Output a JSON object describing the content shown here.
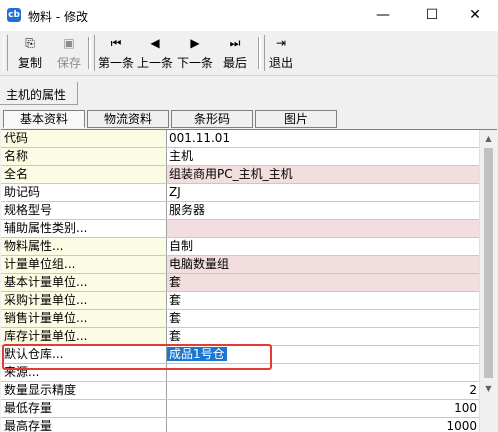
{
  "window": {
    "icon_text": "cb",
    "title": "物料 - 修改",
    "minimize": "—",
    "maximize": "☐",
    "close": "✕"
  },
  "toolbar": {
    "buttons": [
      {
        "label": "复制",
        "icon": "copy-icon",
        "glyph": "⎘",
        "enabled": true
      },
      {
        "label": "保存",
        "icon": "save-icon",
        "glyph": "▣",
        "enabled": false
      },
      {
        "label": "第一条",
        "icon": "first-record-icon",
        "glyph": "⏮",
        "enabled": true
      },
      {
        "label": "上一条",
        "icon": "previous-record-icon",
        "glyph": "◀",
        "enabled": true
      },
      {
        "label": "下一条",
        "icon": "next-record-icon",
        "glyph": "▶",
        "enabled": true
      },
      {
        "label": "最后",
        "icon": "last-record-icon",
        "glyph": "⏭",
        "enabled": true
      },
      {
        "label": "退出",
        "icon": "exit-icon",
        "glyph": "⇥",
        "enabled": true
      }
    ]
  },
  "section": {
    "label": "主机的属性"
  },
  "tabs": [
    "基本资料",
    "物流资料",
    "条形码",
    "图片"
  ],
  "properties": [
    {
      "name": "代码",
      "value": "001.11.01",
      "required": true,
      "pink": false
    },
    {
      "name": "名称",
      "value": "主机",
      "required": true,
      "pink": false
    },
    {
      "name": "全名",
      "value": "组装商用PC_主机_主机",
      "required": true,
      "pink": true
    },
    {
      "name": "助记码",
      "value": "ZJ",
      "required": false,
      "pink": false
    },
    {
      "name": "规格型号",
      "value": "服务器",
      "required": false,
      "pink": false
    },
    {
      "name": "辅助属性类别...",
      "value": "",
      "required": false,
      "pink": true
    },
    {
      "name": "物料属性...",
      "value": "自制",
      "required": true,
      "pink": false
    },
    {
      "name": "计量单位组...",
      "value": "电脑数量组",
      "required": true,
      "pink": true
    },
    {
      "name": "基本计量单位...",
      "value": "套",
      "required": true,
      "pink": true
    },
    {
      "name": "采购计量单位...",
      "value": "套",
      "required": true,
      "pink": false
    },
    {
      "name": "销售计量单位...",
      "value": "套",
      "required": true,
      "pink": false
    },
    {
      "name": "库存计量单位...",
      "value": "套",
      "required": true,
      "pink": false
    },
    {
      "name": "默认仓库...",
      "value": "成品1号仓",
      "required": false,
      "pink": false,
      "selected": true
    },
    {
      "name": "来源...",
      "value": "",
      "required": false,
      "pink": false
    },
    {
      "name": "数量显示精度",
      "value": "2",
      "required": false,
      "pink": false,
      "align": "right"
    },
    {
      "name": "最低存量",
      "value": "100",
      "required": false,
      "pink": false,
      "align": "right"
    },
    {
      "name": "最高存量",
      "value": "1000",
      "required": false,
      "pink": false,
      "align": "right"
    }
  ]
}
